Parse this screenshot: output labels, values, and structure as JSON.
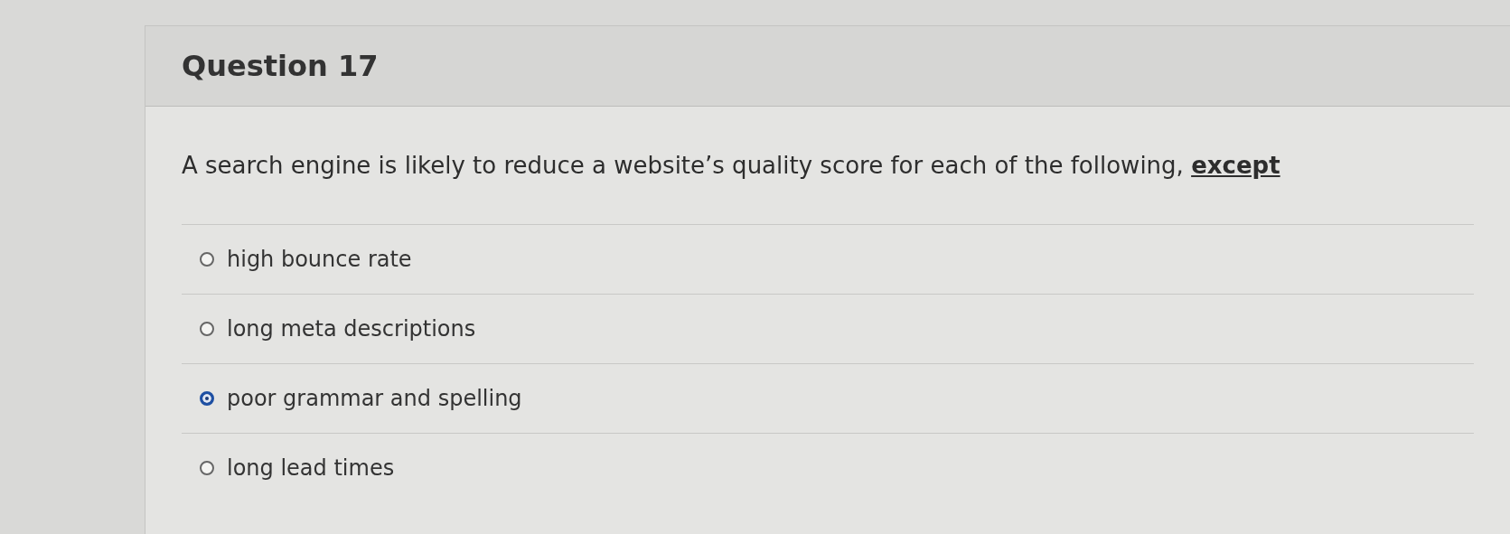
{
  "question": {
    "title": "Question 17",
    "prompt": "A search engine is likely to reduce a website’s quality score for each of the following, ",
    "emphasis": "except"
  },
  "options": [
    {
      "label": "high bounce rate",
      "selected": false
    },
    {
      "label": "long meta descriptions",
      "selected": false
    },
    {
      "label": "poor grammar and spelling",
      "selected": true
    },
    {
      "label": "long lead times",
      "selected": false
    }
  ]
}
